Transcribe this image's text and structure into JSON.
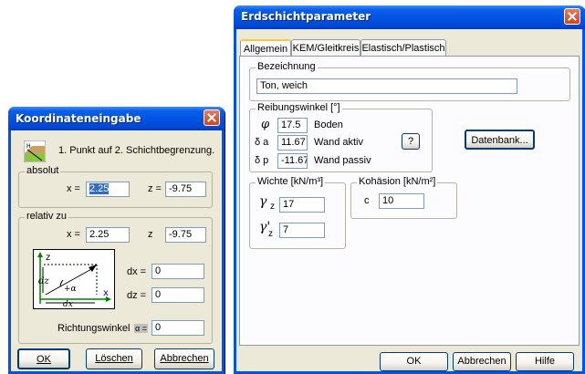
{
  "koord": {
    "title": "Koordinateneingabe",
    "instruction": "1. Punkt auf 2. Schichtbegrenzung.",
    "absolut": {
      "legend": "absolut",
      "x_label": "x =",
      "x_value": "2.25",
      "z_label": "z =",
      "z_value": "-9.75"
    },
    "relativ": {
      "legend": "relativ zu",
      "x_label": "x =",
      "x_value": "2.25",
      "z_label": "z",
      "z_value": "-9.75",
      "dx_label": "dx =",
      "dx_value": "0",
      "dz_label": "dz =",
      "dz_value": "0",
      "richtung_label": "Richtungswinkel",
      "alpha_label": "α =",
      "richtung_value": "0"
    },
    "diagram": {
      "z": "z",
      "x": "x",
      "dz": "dz",
      "dx": "dx",
      "alpha": "+α"
    },
    "buttons": {
      "ok": "OK",
      "loeschen": "Löschen",
      "abbrechen": "Abbrechen"
    }
  },
  "erd": {
    "title": "Erdschichtparameter",
    "tabs": [
      "Allgemein",
      "KEM/Gleitkreis",
      "Elastisch/Plastisch"
    ],
    "bezeichnung": {
      "legend": "Bezeichnung",
      "value": "Ton, weich"
    },
    "reibung": {
      "legend": "Reibungswinkel  [°]",
      "phi_symbol": "φ",
      "phi_value": "17.5",
      "phi_label": "Boden",
      "da_symbol": "δ a",
      "da_value": "11.67",
      "da_label": "Wand aktiv",
      "help_button": "?",
      "dp_symbol": "δ p",
      "dp_value": "-11.67",
      "dp_label": "Wand passiv"
    },
    "datenbank_button": "Datenbank...",
    "wichte": {
      "legend": "Wichte  [kN/m³]",
      "gz_symbol": "γ",
      "gz_sub": "z",
      "gz_value": "17",
      "gz2_symbol": "γ'",
      "gz2_sub": "z",
      "gz2_value": "7"
    },
    "kohaesion": {
      "legend": "Kohäsion  [kN/m²]",
      "c_label": "c",
      "c_value": "10"
    },
    "buttons": {
      "ok": "OK",
      "abbrechen": "Abbrechen",
      "hilfe": "Hilfe"
    }
  }
}
